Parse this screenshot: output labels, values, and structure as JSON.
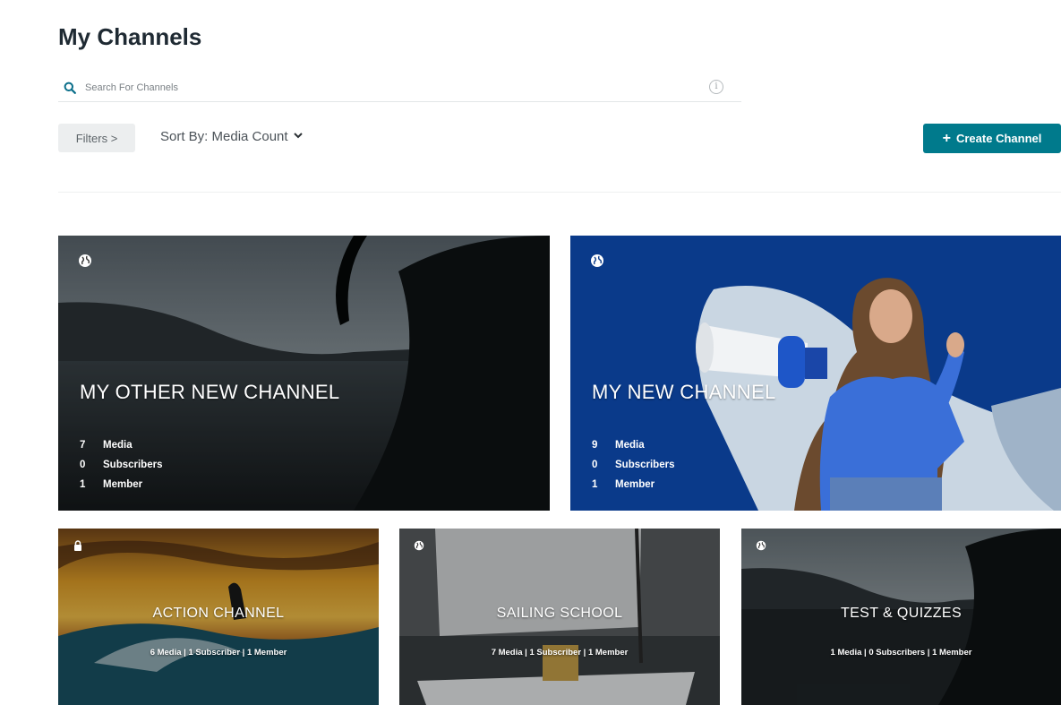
{
  "page": {
    "title": "My Channels"
  },
  "search": {
    "placeholder": "Search For Channels",
    "value": ""
  },
  "toolbar": {
    "filters_label": "Filters >",
    "sort_label": "Sort By: Media Count",
    "create_label": "Create Channel"
  },
  "colors": {
    "accent": "#007a8c",
    "blue_card": "#0a3a8a"
  },
  "channels_featured": [
    {
      "title": "MY OTHER NEW CHANNEL",
      "privacy_icon": "globe-icon",
      "media_count": "7",
      "media_label": "Media",
      "subscriber_count": "0",
      "subscriber_label": "Subscribers",
      "member_count": "1",
      "member_label": "Member"
    },
    {
      "title": "MY NEW CHANNEL",
      "privacy_icon": "globe-icon",
      "media_count": "9",
      "media_label": "Media",
      "subscriber_count": "0",
      "subscriber_label": "Subscribers",
      "member_count": "1",
      "member_label": "Member"
    }
  ],
  "channels_grid": [
    {
      "title": "ACTION CHANNEL",
      "privacy_icon": "lock-icon",
      "stats": "6 Media |  1 Subscriber  |  1 Member"
    },
    {
      "title": "SAILING SCHOOL",
      "privacy_icon": "globe-icon",
      "stats": "7 Media |  1 Subscriber  |  1 Member"
    },
    {
      "title": "TEST & QUIZZES",
      "privacy_icon": "globe-icon",
      "stats": "1 Media |  0 Subscribers  |  1 Member"
    }
  ]
}
